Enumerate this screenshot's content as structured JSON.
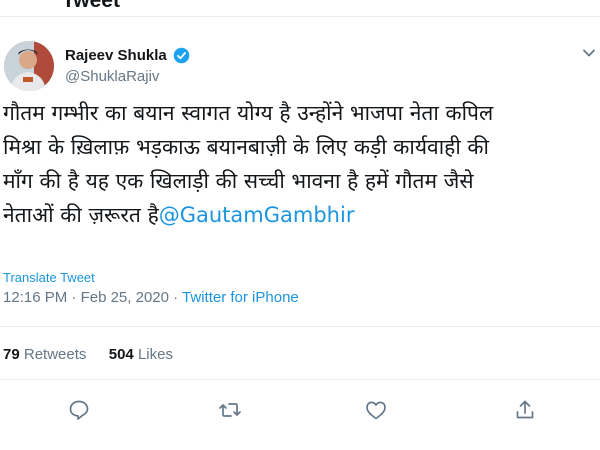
{
  "header": {
    "title": "Tweet"
  },
  "author": {
    "name": "Rajeev Shukla",
    "handle": "@ShuklaRajiv",
    "verified_color": "#1da1f2"
  },
  "tweet": {
    "lines": [
      "गौतम गम्भीर का बयान स्वागत योग्य है उन्होंने भाजपा नेता कपिल",
      "मिश्रा के ख़िलाफ़ भड़काऊ बयानबाज़ी के लिए कड़ी कार्यवाही की",
      "माँग की है यह एक खिलाड़ी की सच्ची भावना है हमें गौतम जैसे",
      "नेताओं की ज़रूरत है"
    ],
    "mention": "@GautamGambhir"
  },
  "translate_label": "Translate Tweet",
  "meta": {
    "time": "12:16 PM",
    "separator1": " · ",
    "date": "Feb 25, 2020",
    "separator2": " · ",
    "source": "Twitter for iPhone"
  },
  "stats": {
    "retweets_count": "79",
    "retweets_label": "Retweets",
    "likes_count": "504",
    "likes_label": "Likes"
  },
  "actions": {
    "reply_icon": "reply-icon",
    "retweet_icon": "retweet-icon",
    "like_icon": "heart-icon",
    "share_icon": "share-icon"
  },
  "colors": {
    "link": "#1b95e0",
    "secondary_text": "#657786",
    "divider": "#e6ecf0"
  }
}
